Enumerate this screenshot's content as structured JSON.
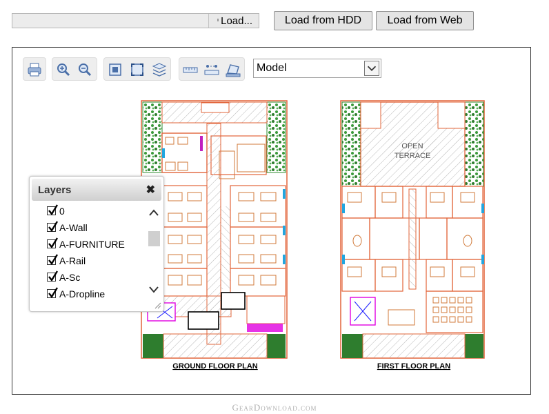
{
  "toolbar": {
    "file_button_label": "Load...",
    "load_hdd_label": "Load from HDD",
    "load_web_label": "Load from Web"
  },
  "viewer": {
    "tools": [
      {
        "name": "print-icon"
      },
      {
        "name": "zoom-in-icon"
      },
      {
        "name": "zoom-out-icon"
      },
      {
        "name": "zoom-window-icon"
      },
      {
        "name": "zoom-extents-icon"
      },
      {
        "name": "layers-icon"
      },
      {
        "name": "measure-distance-icon"
      },
      {
        "name": "measure-points-icon"
      },
      {
        "name": "measure-area-icon"
      }
    ],
    "space_select": {
      "value": "Model"
    }
  },
  "drawing": {
    "ground_floor_title": "GROUND FLOOR PLAN",
    "first_floor_title": "FIRST FLOOR PLAN",
    "terrace_label_line1": "OPEN",
    "terrace_label_line2": "TERRACE",
    "colors": {
      "wall": "#e2643a",
      "landscape": "#2e8b2e",
      "hatch": "#b8b8b8",
      "stair": "#e000e0",
      "window": "#21a6e0"
    }
  },
  "layers_panel": {
    "title": "Layers",
    "items": [
      {
        "label": "0",
        "checked": true
      },
      {
        "label": "A-Wall",
        "checked": true
      },
      {
        "label": "A-FURNITURE",
        "checked": true
      },
      {
        "label": "A-Rail",
        "checked": true
      },
      {
        "label": "A-Sc",
        "checked": true
      },
      {
        "label": "A-Dropline",
        "checked": true
      }
    ]
  },
  "watermark": "GearDownload.com"
}
